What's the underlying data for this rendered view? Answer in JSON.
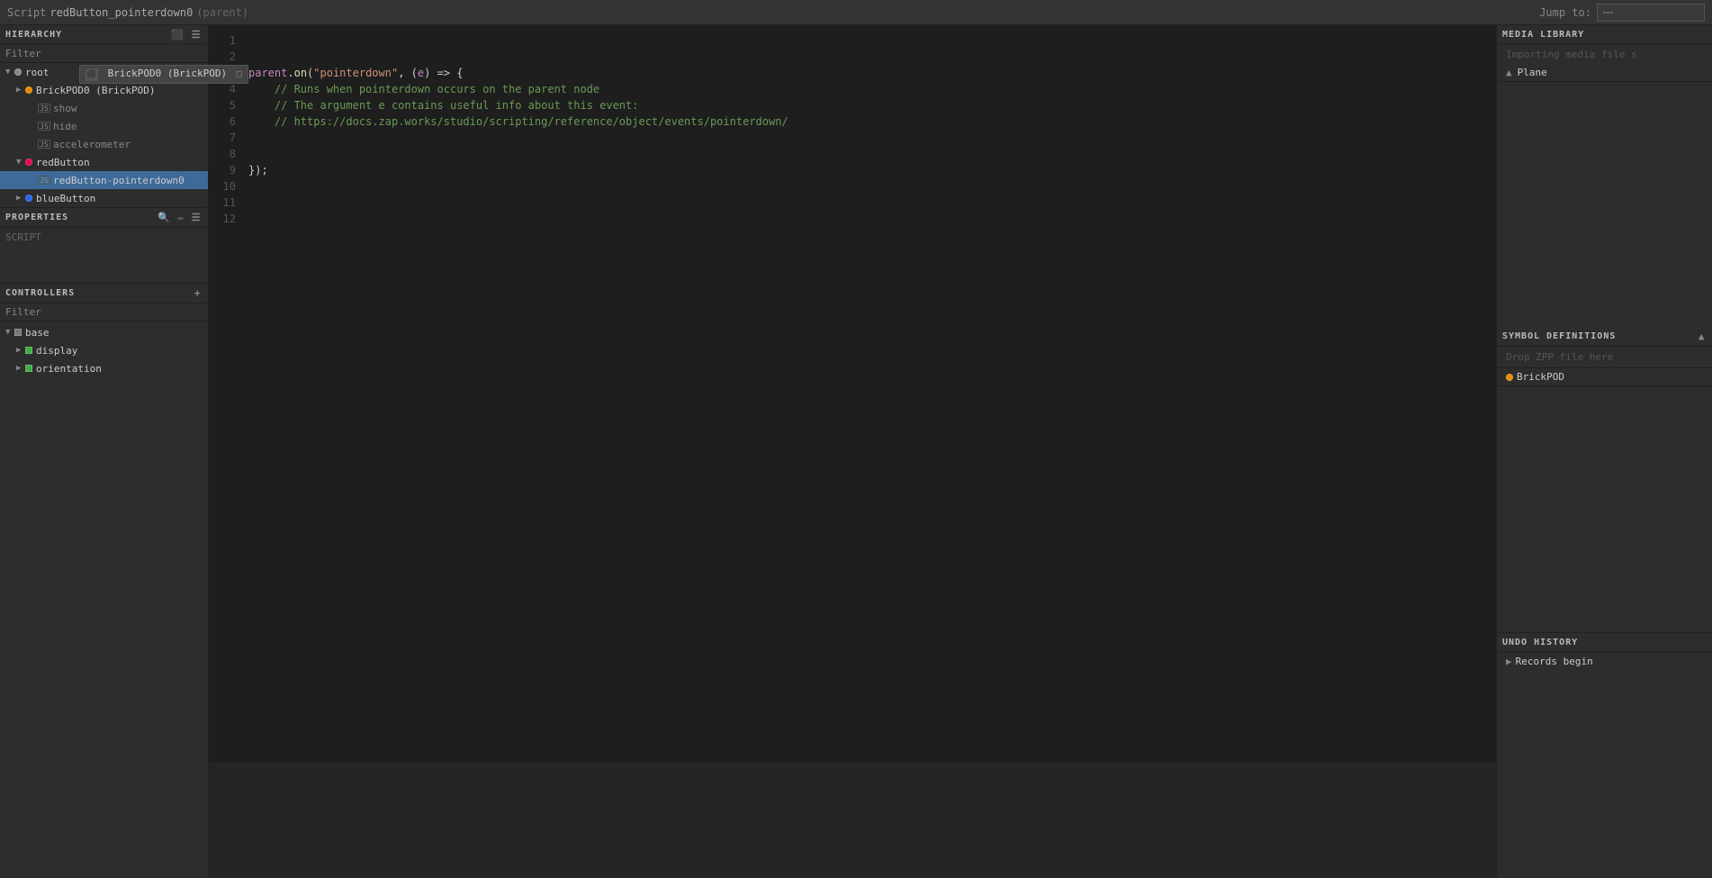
{
  "topbar": {
    "script_label": "Script",
    "script_name": "redButton_pointerdown0",
    "script_parent": "(parent)",
    "jump_to_label": "Jump to:",
    "jump_to_placeholder": "---"
  },
  "hierarchy": {
    "panel_title": "HIERARCHY",
    "filter_label": "Filter",
    "tree": [
      {
        "id": "root",
        "label": "root",
        "indent": 0,
        "type": "root",
        "expanded": true
      },
      {
        "id": "brickpod0",
        "label": "BrickPOD0 (BrickPOD)",
        "indent": 1,
        "type": "brickpod",
        "expanded": false
      },
      {
        "id": "show",
        "label": "show",
        "indent": 2,
        "type": "event"
      },
      {
        "id": "hide",
        "label": "hide",
        "indent": 2,
        "type": "event"
      },
      {
        "id": "accelerometer",
        "label": "accelerometer",
        "indent": 2,
        "type": "event"
      },
      {
        "id": "redbutton",
        "label": "redButton",
        "indent": 1,
        "type": "node",
        "expanded": true
      },
      {
        "id": "redbutton_pointerdown0",
        "label": "redButton-pointerdown0",
        "indent": 2,
        "type": "script",
        "selected": true
      },
      {
        "id": "bluebutton",
        "label": "blueButton",
        "indent": 1,
        "type": "node",
        "expanded": false
      }
    ]
  },
  "properties": {
    "panel_title": "PROPERTIES",
    "script_label": "SCRIPT"
  },
  "controllers": {
    "panel_title": "CONTROLLERS",
    "filter_label": "Filter",
    "tree": [
      {
        "id": "base",
        "label": "base",
        "indent": 0,
        "type": "base",
        "expanded": true
      },
      {
        "id": "display",
        "label": "display",
        "indent": 1,
        "type": "display",
        "expanded": false
      },
      {
        "id": "orientation",
        "label": "orientation",
        "indent": 1,
        "type": "orientation",
        "expanded": false
      }
    ]
  },
  "code": {
    "lines": [
      "",
      "",
      "parent.on(\"pointerdown\", (e) => {",
      "    // Runs when pointerdown occurs on the parent node",
      "    // The argument e contains useful info about this event:",
      "    // https://docs.zap.works/studio/scripting/reference/object/events/pointerdown/",
      "",
      "",
      "});"
    ],
    "line_count": 12
  },
  "media_library": {
    "panel_title": "MEDIA LIBRARY",
    "importing_text": "Importing media file s",
    "items": [
      {
        "label": "Plane",
        "icon": "triangle"
      }
    ]
  },
  "symbol_definitions": {
    "panel_title": "SYMBOL DEFINITIONS",
    "drop_zone_text": "Drop ZPP file here",
    "items": [
      {
        "label": "BrickPOD",
        "icon": "circle"
      }
    ]
  },
  "undo_history": {
    "panel_title": "UNDO HISTORY",
    "items": [
      {
        "label": "Records begin"
      }
    ]
  },
  "tooltip": {
    "text": "BrickPOD0 (BrickPOD)"
  }
}
